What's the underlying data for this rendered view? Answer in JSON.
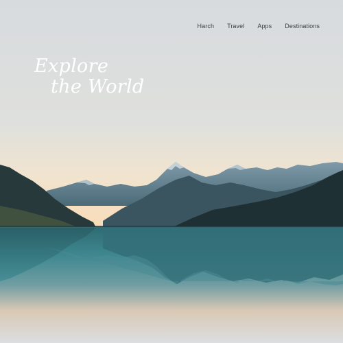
{
  "nav": {
    "items": [
      {
        "label": "Harch"
      },
      {
        "label": "Travel"
      },
      {
        "label": "Apps"
      },
      {
        "label": "Destinations"
      }
    ]
  },
  "hero": {
    "title_line_1": "Explore",
    "title_line_2": "the World"
  },
  "colors": {
    "sky_top": "#d8dcdf",
    "horizon_glow": "#f7dfbf",
    "mountain_dark": "#24343a",
    "lake_teal": "#2f7780",
    "title_text": "#ffffff",
    "nav_text": "#3a3f44"
  }
}
